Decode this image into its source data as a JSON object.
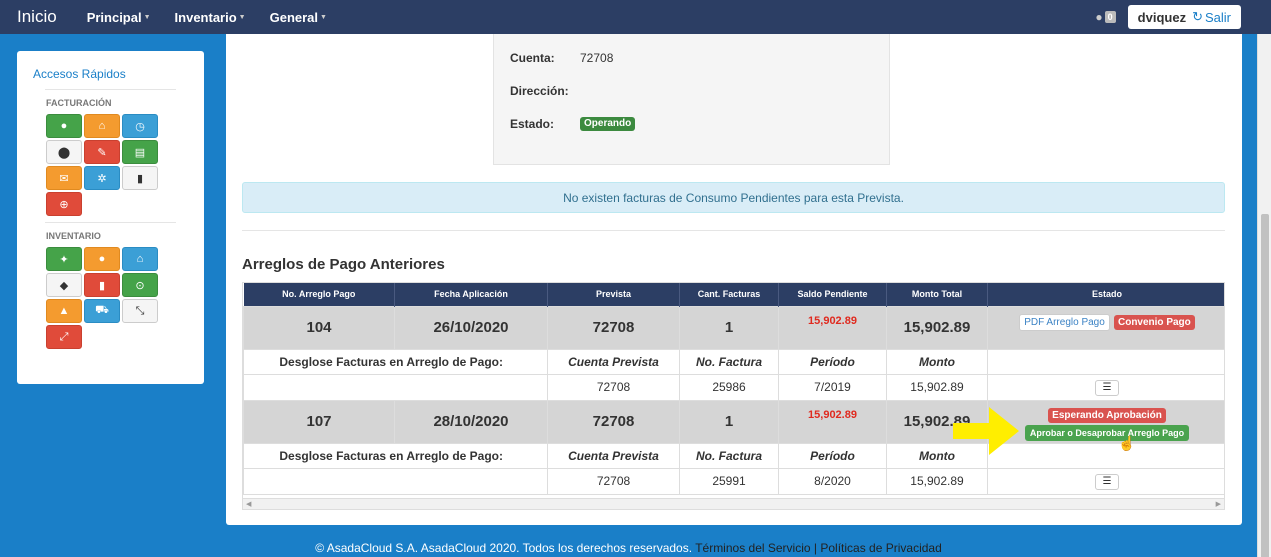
{
  "navbar": {
    "brand": "Inicio",
    "menus": [
      "Principal",
      "Inventario",
      "General"
    ],
    "notification_count": "0",
    "user": "dviquez",
    "logout": "Salir"
  },
  "sidebar": {
    "title": "Accesos Rápidos",
    "facturacion_label": "FACTURACIÓN",
    "inventario_label": "INVENTARIO"
  },
  "account": {
    "cuenta_label": "Cuenta:",
    "cuenta_value": "72708",
    "direccion_label": "Dirección:",
    "direccion_value": "",
    "estado_label": "Estado:",
    "estado_value": "Operando"
  },
  "alert": "No existen facturas de Consumo Pendientes para esta Prevista.",
  "section_title": "Arreglos de Pago Anteriores",
  "table": {
    "headers": [
      "No. Arreglo Pago",
      "Fecha Aplicación",
      "Prevista",
      "Cant. Facturas",
      "Saldo Pendiente",
      "Monto Total",
      "Estado"
    ],
    "sub_headers": [
      "Desglose Facturas en Arreglo de Pago:",
      "Cuenta Prevista",
      "No. Factura",
      "Período",
      "Monto"
    ],
    "rows": [
      {
        "no": "104",
        "fecha": "26/10/2020",
        "prevista": "72708",
        "cant": "1",
        "saldo": "15,902.89",
        "monto": "15,902.89",
        "estado_a": "PDF Arreglo Pago",
        "estado_b": "Convenio Pago",
        "detail": {
          "cuenta": "72708",
          "factura": "25986",
          "periodo": "7/2019",
          "monto": "15,902.89"
        }
      },
      {
        "no": "107",
        "fecha": "28/10/2020",
        "prevista": "72708",
        "cant": "1",
        "saldo": "15,902.89",
        "monto": "15,902.89",
        "estado_a": "Esperando Aprobación",
        "estado_b": "Aprobar o Desaprobar Arreglo Pago",
        "detail": {
          "cuenta": "72708",
          "factura": "25991",
          "periodo": "8/2020",
          "monto": "15,902.89"
        }
      }
    ]
  },
  "footer": {
    "copyright": "© AsadaCloud S.A. AsadaCloud 2020. Todos los derechos reservados.",
    "terms": "Términos del Servicio",
    "separator": "|",
    "privacy": "Políticas de Privacidad"
  }
}
